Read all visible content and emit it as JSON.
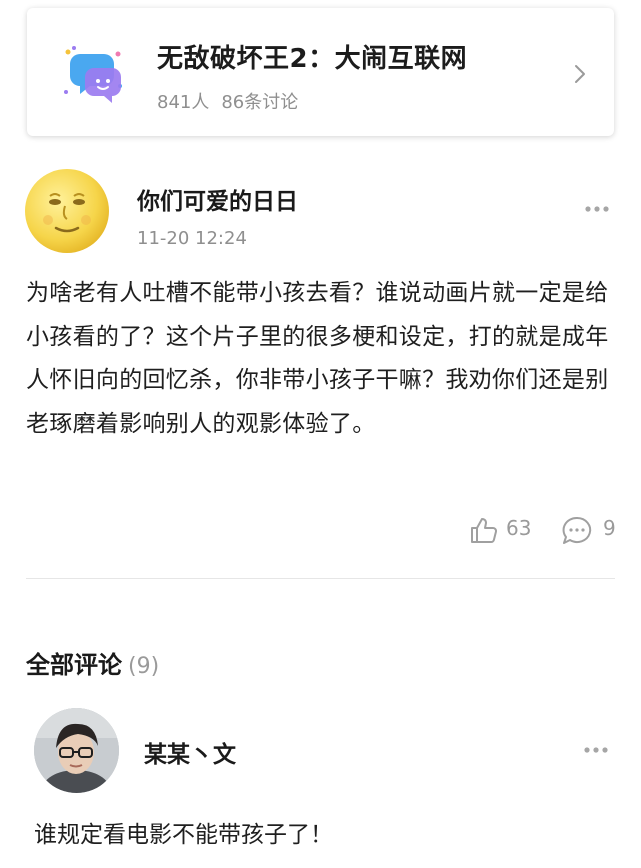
{
  "topic": {
    "title": "无敌破坏王2：大闹互联网",
    "members": "841人",
    "discussions": "86条讨论",
    "icon": "chat-bubbles-icon"
  },
  "post": {
    "author": "你们可爱的日日",
    "time": "11-20 12:24",
    "body": "为啥老有人吐槽不能带小孩去看？谁说动画片就一定是给小孩看的了？这个片子里的很多梗和设定，打的就是成年人怀旧向的回忆杀，你非带小孩子干嘛？我劝你们还是别老琢磨着影响别人的观影体验了。",
    "likes": "63",
    "comments": "9"
  },
  "comments_section": {
    "title": "全部评论",
    "count": "(9)",
    "items": [
      {
        "author": "某某丶文",
        "text": "谁规定看电影不能带孩子了！"
      }
    ]
  },
  "colors": {
    "accent_blue": "#4aa8f0",
    "accent_purple": "#9b7cf0",
    "muted_text": "#8f8f8f"
  }
}
